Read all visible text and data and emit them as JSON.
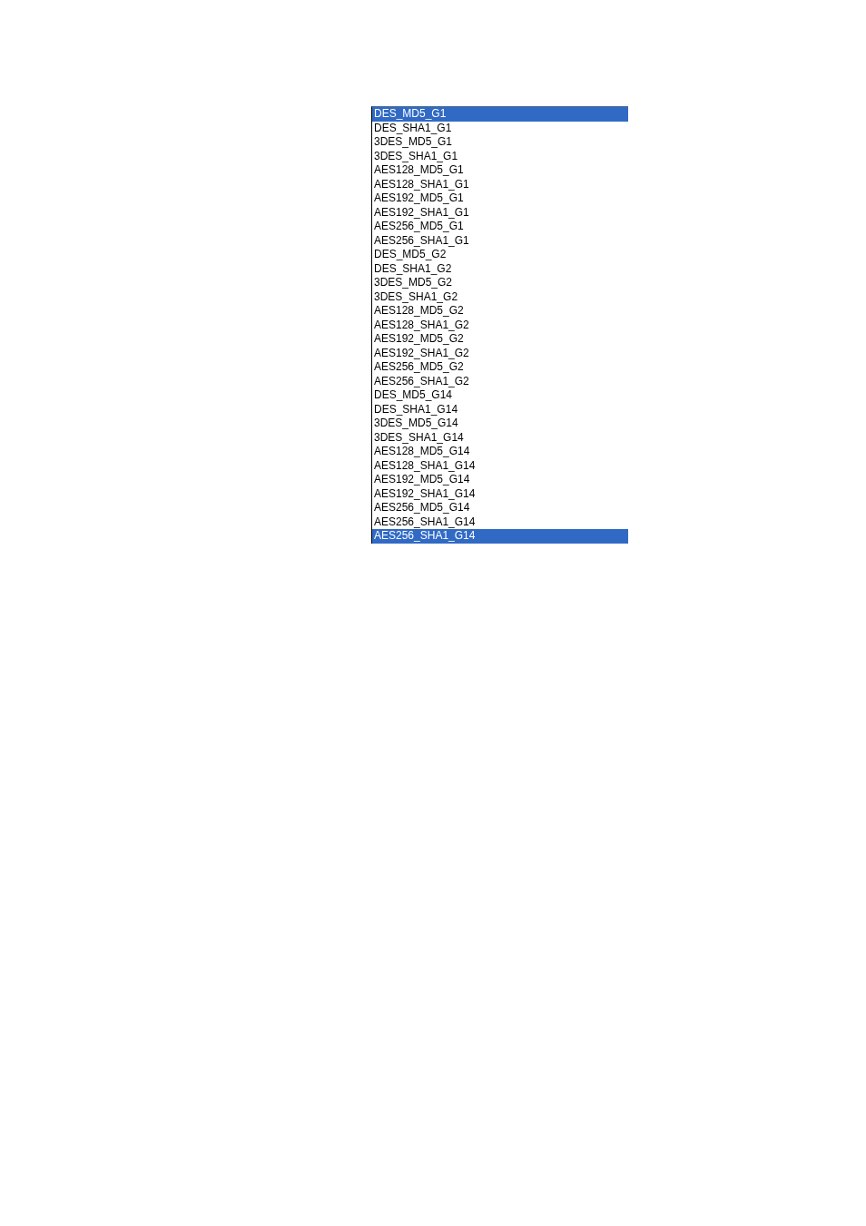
{
  "dropdown_list": {
    "items": [
      {
        "label": "DES_MD5_G1",
        "selected": true
      },
      {
        "label": "DES_SHA1_G1",
        "selected": false
      },
      {
        "label": "3DES_MD5_G1",
        "selected": false
      },
      {
        "label": "3DES_SHA1_G1",
        "selected": false
      },
      {
        "label": "AES128_MD5_G1",
        "selected": false
      },
      {
        "label": "AES128_SHA1_G1",
        "selected": false
      },
      {
        "label": "AES192_MD5_G1",
        "selected": false
      },
      {
        "label": "AES192_SHA1_G1",
        "selected": false
      },
      {
        "label": "AES256_MD5_G1",
        "selected": false
      },
      {
        "label": "AES256_SHA1_G1",
        "selected": false
      },
      {
        "label": "DES_MD5_G2",
        "selected": false
      },
      {
        "label": "DES_SHA1_G2",
        "selected": false
      },
      {
        "label": "3DES_MD5_G2",
        "selected": false
      },
      {
        "label": "3DES_SHA1_G2",
        "selected": false
      },
      {
        "label": "AES128_MD5_G2",
        "selected": false
      },
      {
        "label": "AES128_SHA1_G2",
        "selected": false
      },
      {
        "label": "AES192_MD5_G2",
        "selected": false
      },
      {
        "label": "AES192_SHA1_G2",
        "selected": false
      },
      {
        "label": "AES256_MD5_G2",
        "selected": false
      },
      {
        "label": "AES256_SHA1_G2",
        "selected": false
      },
      {
        "label": "DES_MD5_G14",
        "selected": false
      },
      {
        "label": "DES_SHA1_G14",
        "selected": false
      },
      {
        "label": "3DES_MD5_G14",
        "selected": false
      },
      {
        "label": "3DES_SHA1_G14",
        "selected": false
      },
      {
        "label": "AES128_MD5_G14",
        "selected": false
      },
      {
        "label": "AES128_SHA1_G14",
        "selected": false
      },
      {
        "label": "AES192_MD5_G14",
        "selected": false
      },
      {
        "label": "AES192_SHA1_G14",
        "selected": false
      },
      {
        "label": "AES256_MD5_G14",
        "selected": false
      },
      {
        "label": "AES256_SHA1_G14",
        "selected": false
      },
      {
        "label": "AES256_SHA1_G14",
        "selected": true
      }
    ]
  }
}
